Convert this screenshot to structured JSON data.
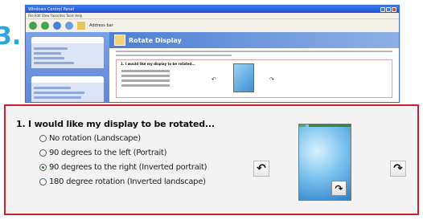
{
  "step": {
    "number": "3."
  },
  "thumbnail": {
    "window_title": "Windows Control Panel",
    "menubar": "File  Edit  View  Favorites  Tools  Help",
    "toolbar_label": "Address bar",
    "banner_title": "Rotate Display",
    "box_title": "1. I would like my display to be rotated..."
  },
  "rotate": {
    "heading": "1. I would like my display to be rotated...",
    "options": [
      {
        "label": "No rotation (Landscape)",
        "checked": false
      },
      {
        "label": "90 degrees to the left (Portrait)",
        "checked": false
      },
      {
        "label": "90 degrees to the right (Inverted portrait)",
        "checked": true
      },
      {
        "label": "180 degree rotation (Inverted landscape)",
        "checked": false
      }
    ],
    "rotate_left_glyph": "↶",
    "rotate_right_glyph": "↷",
    "preview_glyph": "↷"
  },
  "colors": {
    "highlight_border": "#c8212a",
    "step_number": "#2aa6dc",
    "xp_titlebar": "#1c4fd2"
  }
}
